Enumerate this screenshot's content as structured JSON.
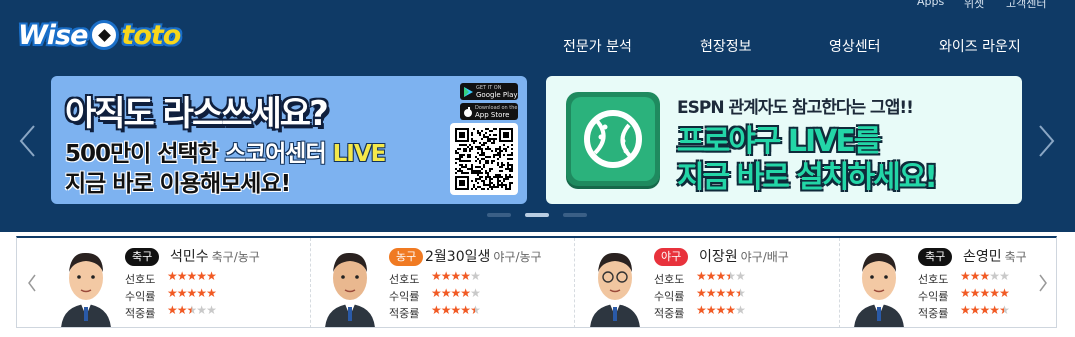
{
  "utility": {
    "apps": "Apps",
    "widget": "위젯",
    "support": "고객센터"
  },
  "logo": {
    "left": "Wise",
    "right": "toto"
  },
  "nav": [
    {
      "label": "전문가 분석"
    },
    {
      "label": "현장정보"
    },
    {
      "label": "영상센터"
    },
    {
      "label": "와이즈 라운지"
    }
  ],
  "banner1": {
    "headline": "아직도 라스쓰세요?",
    "line1_prefix": "500만이 선택한 ",
    "line1_highlight": "스코어센터 ",
    "line1_live": "LIVE",
    "line2": "지금 바로 이용해보세요!",
    "google_play_small": "GET IT ON",
    "google_play": "Google Play",
    "app_store_small": "Download on the",
    "app_store": "App Store"
  },
  "banner2": {
    "sub": "ESPN 관계자도 참고한다는 그앱!!",
    "line1": "프로야구 LIVE를",
    "line2": "지금 바로 설치하세요!"
  },
  "experts": [
    {
      "badge": "축구",
      "badge_color": "#111111",
      "name": "석민수",
      "sports": "축구/농구",
      "labels": [
        "선호도",
        "수익률",
        "적중률"
      ],
      "ratings": [
        5,
        5,
        2.5
      ]
    },
    {
      "badge": "농구",
      "badge_color": "#f07a22",
      "name": "2월30일생",
      "sports": "야구/농구",
      "labels": [
        "선호도",
        "수익률",
        "적중률"
      ],
      "ratings": [
        4,
        4,
        4.5
      ]
    },
    {
      "badge": "야구",
      "badge_color": "#e8323c",
      "name": "이장원",
      "sports": "야구/배구",
      "labels": [
        "선호도",
        "수익률",
        "적중률"
      ],
      "ratings": [
        3.5,
        4.5,
        4
      ]
    },
    {
      "badge": "축구",
      "badge_color": "#111111",
      "name": "손영민",
      "sports": "축구",
      "labels": [
        "선호도",
        "수익률",
        "적중률"
      ],
      "ratings": [
        3,
        5,
        4.5
      ]
    }
  ],
  "colors": {
    "header_bg": "#0f3a66",
    "star": "#f15a24",
    "banner1_bg": "#7db2f0",
    "banner2_bg": "#e8fbf8"
  }
}
